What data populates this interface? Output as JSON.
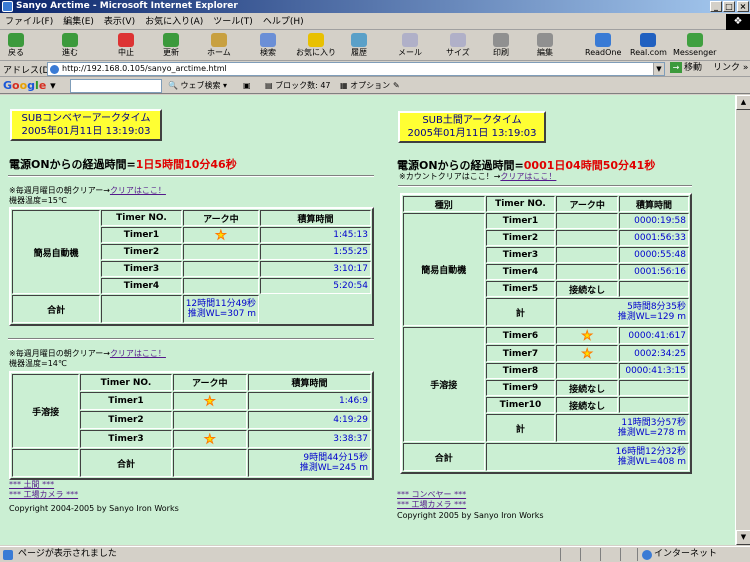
{
  "window": {
    "title": "Sanyo Arctime - Microsoft Internet Explorer"
  },
  "menu": [
    "ファイル(F)",
    "編集(E)",
    "表示(V)",
    "お気に入り(A)",
    "ツール(T)",
    "ヘルプ(H)"
  ],
  "toolbar": [
    "戻る",
    "進む",
    "中止",
    "更新",
    "ホーム",
    "検索",
    "お気に入り",
    "履歴",
    "メール",
    "サイズ",
    "印刷",
    "編集",
    "ReadOne",
    "Real.com",
    "Messenger"
  ],
  "address": {
    "label": "アドレス(D)",
    "url": "http://192.168.0.105/sanyo_arctime.html",
    "go": "移動",
    "links": "リンク »"
  },
  "googlebar": {
    "logo": "Google",
    "web_search": "ウェブ検索",
    "blocked": "ブロック数: 47",
    "options": "オプション"
  },
  "left": {
    "title_line1": "SUBコンベヤーアークタイム",
    "title_line2": "2005年01月11日  13:19:03",
    "elapsed_prefix": "電源ONからの経過時間=",
    "elapsed_value": "1日5時間10分46秒",
    "block1": {
      "note": "※毎週月曜日の朝クリアー→",
      "clear_link": "クリアはここ！",
      "temp": "機器温度=15℃",
      "headers": [
        "Timer NO.",
        "アーク中",
        "積算時間"
      ],
      "group": "簡易自動機",
      "rows": [
        {
          "name": "Timer1",
          "arc": true,
          "time": "1:45:13"
        },
        {
          "name": "Timer2",
          "arc": false,
          "time": "1:55:25"
        },
        {
          "name": "Timer3",
          "arc": false,
          "time": "3:10:17"
        },
        {
          "name": "Timer4",
          "arc": false,
          "time": "5:20:54"
        }
      ],
      "total_label": "合計",
      "total_time": "12時間11分49秒",
      "total_wl": "推測WL=307 m"
    },
    "block2": {
      "note": "※毎週月曜日の朝クリアー→",
      "clear_link": "クリアはここ！",
      "temp": "機器温度=14℃",
      "headers": [
        "Timer NO.",
        "アーク中",
        "積算時間"
      ],
      "group": "手溶接",
      "rows": [
        {
          "name": "Timer1",
          "arc": true,
          "time": "1:46:9"
        },
        {
          "name": "Timer2",
          "arc": false,
          "time": "4:19:29"
        },
        {
          "name": "Timer3",
          "arc": true,
          "time": "3:38:37"
        }
      ],
      "total_label": "合計",
      "total_time": "9時間44分15秒",
      "total_wl": "推測WL=245 m"
    },
    "links": [
      "*** 土間 ***",
      "*** 工場カメラ ***"
    ],
    "copyright": "Copyright 2004-2005 by Sanyo Iron Works"
  },
  "right": {
    "title_line1": "SUB土間アークタイム",
    "title_line2": "2005年01月11日  13:19:03",
    "elapsed_prefix": "電源ONからの経過時間=",
    "elapsed_value": "0001日04時間50分41秒",
    "note": "※カウントクリアはここ！→",
    "clear_link": "クリアはここ！",
    "headers": [
      "種別",
      "Timer NO.",
      "アーク中",
      "積算時間"
    ],
    "group1": {
      "name": "簡易自動機",
      "rows": [
        {
          "name": "Timer1",
          "arc": "",
          "time": "0000:19:58"
        },
        {
          "name": "Timer2",
          "arc": "",
          "time": "0001:56:33"
        },
        {
          "name": "Timer3",
          "arc": "",
          "time": "0000:55:48"
        },
        {
          "name": "Timer4",
          "arc": "",
          "time": "0001:56:16"
        },
        {
          "name": "Timer5",
          "arc": "接続なし",
          "time": ""
        }
      ],
      "sub_label": "計",
      "sub_time": "5時間8分35秒",
      "sub_wl": "推測WL=129 m"
    },
    "group2": {
      "name": "手溶接",
      "rows": [
        {
          "name": "Timer6",
          "arc": "star",
          "time": "0000:41:617"
        },
        {
          "name": "Timer7",
          "arc": "star",
          "time": "0002:34:25"
        },
        {
          "name": "Timer8",
          "arc": "",
          "time": "0000:41:3:15"
        },
        {
          "name": "Timer9",
          "arc": "接続なし",
          "time": ""
        },
        {
          "name": "Timer10",
          "arc": "接続なし",
          "time": ""
        }
      ],
      "sub_label": "計",
      "sub_time": "11時間3分57秒",
      "sub_wl": "推測WL=278 m"
    },
    "total_label": "合計",
    "total_time": "16時間12分32秒",
    "total_wl": "推測WL=408 m",
    "links": [
      "*** コンベヤー ***",
      "*** 工場カメラ ***"
    ],
    "copyright": "Copyright 2005 by Sanyo Iron Works"
  },
  "status": {
    "text": "ページが表示されました",
    "zone": "インターネット"
  }
}
